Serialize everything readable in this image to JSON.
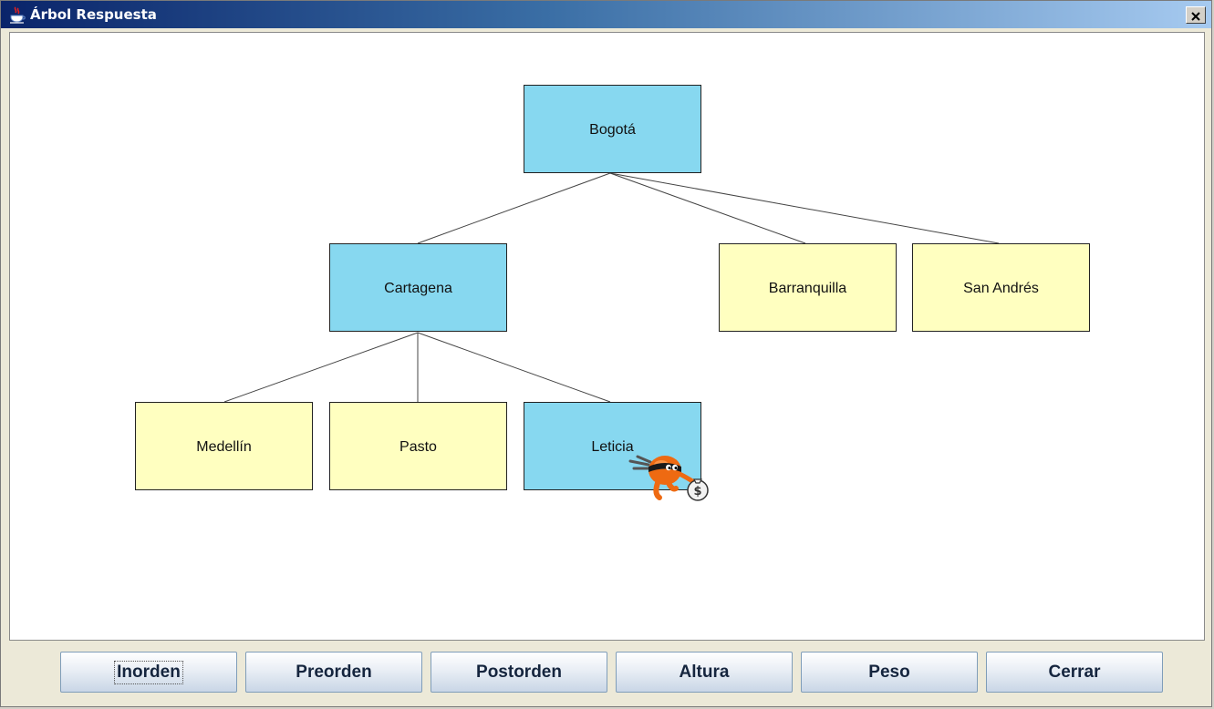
{
  "window": {
    "title": "Árbol Respuesta",
    "close_label": "×"
  },
  "tree": {
    "nodes": {
      "bogota": {
        "label": "Bogotá",
        "state": "highlighted"
      },
      "cartagena": {
        "label": "Cartagena",
        "state": "highlighted"
      },
      "barranquilla": {
        "label": "Barranquilla",
        "state": "normal"
      },
      "san_andres": {
        "label": "San Andrés",
        "state": "normal"
      },
      "medellin": {
        "label": "Medellín",
        "state": "normal"
      },
      "pasto": {
        "label": "Pasto",
        "state": "normal"
      },
      "leticia": {
        "label": "Leticia",
        "state": "highlighted"
      }
    },
    "edges": [
      [
        "bogota",
        "cartagena"
      ],
      [
        "bogota",
        "barranquilla"
      ],
      [
        "bogota",
        "san_andres"
      ],
      [
        "cartagena",
        "medellin"
      ],
      [
        "cartagena",
        "pasto"
      ],
      [
        "cartagena",
        "leticia"
      ]
    ],
    "colors": {
      "highlighted": "#87d8f0",
      "normal": "#ffffc0"
    }
  },
  "buttons": {
    "inorden": "Inorden",
    "preorden": "Preorden",
    "postorden": "Postorden",
    "altura": "Altura",
    "peso": "Peso",
    "cerrar": "Cerrar"
  }
}
